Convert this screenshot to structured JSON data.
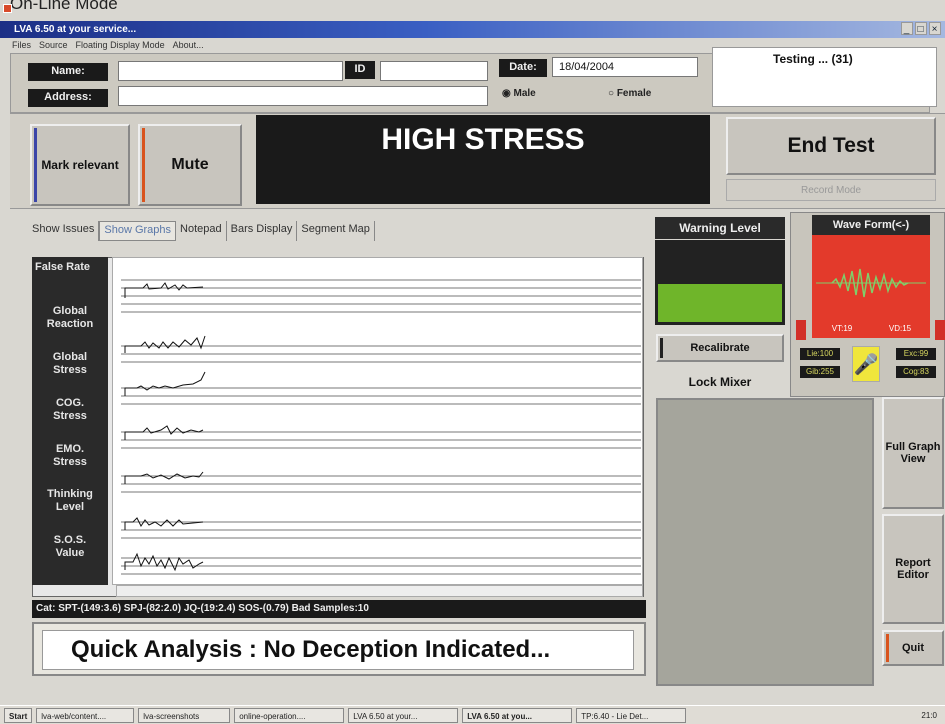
{
  "caption": "On-Line Mode",
  "window": {
    "title": "LVA 6.50 at your service...",
    "controls": [
      "_",
      "□",
      "×"
    ]
  },
  "menu": [
    "Files",
    "Source",
    "Floating Display Mode",
    "About..."
  ],
  "header": {
    "name_label": "Name:",
    "address_label": "Address:",
    "id_label": "ID",
    "date_label": "Date:",
    "date_value": "18/04/2004",
    "gender": {
      "selected": "Male",
      "options": [
        "Male",
        "Female"
      ]
    },
    "testing_status": "Testing ... (31)"
  },
  "controls": {
    "mark_relevant": "Mark relevant",
    "mute": "Mute",
    "stress_banner": "HIGH STRESS",
    "end_test": "End Test",
    "record_mode": "Record Mode"
  },
  "tabs": {
    "labels": [
      "Show Issues",
      "Show Graphs",
      "Notepad",
      "Bars Display",
      "Segment Map"
    ],
    "active": "Show Graphs"
  },
  "graph_labels": [
    "False Rate",
    "Global Reaction",
    "Global Stress",
    "COG. Stress",
    "EMO. Stress",
    "Thinking Level",
    "S.O.S. Value"
  ],
  "status_line": "Cat: SPT-(149:3.6) SPJ-(82:2.0) JQ-(19:2.4) SOS-(0.79) Bad Samples:10",
  "quick_analysis": "Quick Analysis : No Deception Indicated...",
  "warning": {
    "title": "Warning Level",
    "level": 0.45,
    "fill_color": "#6fb52a"
  },
  "recalibrate": "Recalibrate",
  "lock_mixer": "Lock Mixer",
  "waveform": {
    "title": "Wave Form(<-)",
    "readouts": [
      "VT:19",
      "VD:15"
    ],
    "meters_left": [
      "Lie:100",
      "Gib:255"
    ],
    "meters_right": [
      "Exc:99",
      "Cog:83"
    ]
  },
  "side_buttons": [
    "Full Graph View",
    "Report Editor",
    "Quit"
  ],
  "taskbar": {
    "start": "Start",
    "tasks": [
      "lva-web/content....",
      "lva-screenshots",
      "online-operation....",
      "LVA 6.50 at your...",
      "LVA 6.50 at you...",
      "TP:6.40 - Lie Det..."
    ],
    "clock": "21:0"
  },
  "colors": {
    "stress_bg": "#1a1a1a",
    "waveform_bg": "#e33a2b",
    "warning_fill": "#6fb52a"
  }
}
